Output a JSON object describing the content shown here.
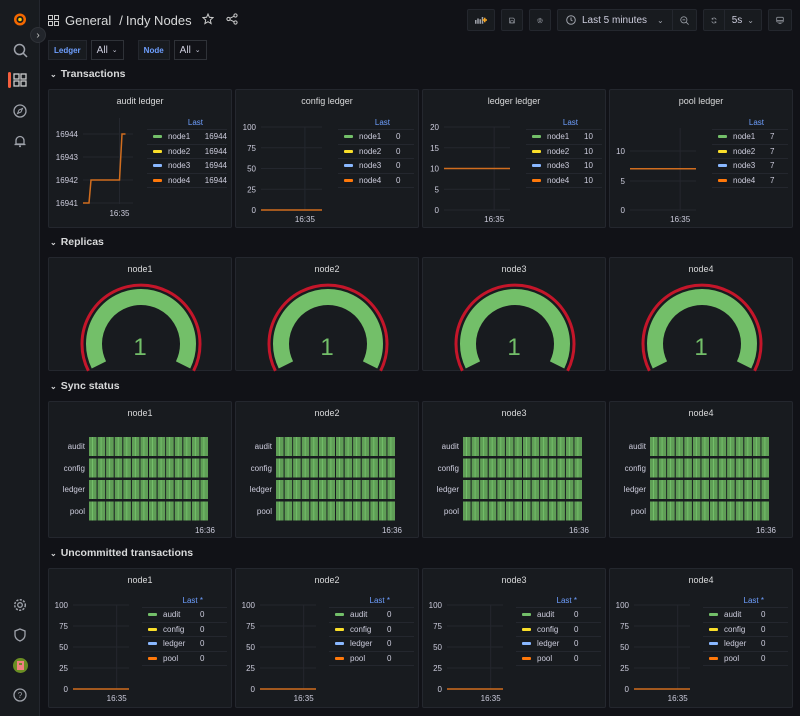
{
  "sidebar": {
    "items": [
      {
        "icon": "grafana-logo-icon"
      },
      {
        "icon": "search-icon"
      },
      {
        "icon": "dashboards-icon",
        "active": true
      },
      {
        "icon": "explore-compass-icon"
      },
      {
        "icon": "alerting-bell-icon"
      },
      {
        "icon": "configuration-gear-icon"
      },
      {
        "icon": "server-admin-shield-icon"
      },
      {
        "icon": "user-avatar-icon"
      },
      {
        "icon": "help-icon"
      }
    ],
    "expand_glyph": "›"
  },
  "header": {
    "folder": "General",
    "separator": "/",
    "title": "Indy Nodes"
  },
  "toolbar": {
    "time_range": "Last 5 minutes",
    "refresh_interval": "5s"
  },
  "variables": [
    {
      "label": "Ledger",
      "value": "All"
    },
    {
      "label": "Node",
      "value": "All"
    }
  ],
  "rows": {
    "transactions": "Transactions",
    "replicas": "Replicas",
    "sync": "Sync status",
    "uncommitted": "Uncommitted transactions"
  },
  "colors": {
    "node1": "#73bf69",
    "node2": "#fade2a",
    "node3": "#8ab8ff",
    "node4": "#ff780a",
    "gauge_green": "#73bf69",
    "gauge_red": "#c4162a",
    "accent": "#6e9fff"
  },
  "transactions": [
    {
      "title": "audit ledger",
      "legend_header": "Last",
      "legend": [
        {
          "name": "node1",
          "value": "16944"
        },
        {
          "name": "node2",
          "value": "16944"
        },
        {
          "name": "node3",
          "value": "16944"
        },
        {
          "name": "node4",
          "value": "16944"
        }
      ],
      "x_tick": "16:35",
      "y_ticks": [
        "16944",
        "16943",
        "16942",
        "16941"
      ]
    },
    {
      "title": "config ledger",
      "legend_header": "Last",
      "legend": [
        {
          "name": "node1",
          "value": "0"
        },
        {
          "name": "node2",
          "value": "0"
        },
        {
          "name": "node3",
          "value": "0"
        },
        {
          "name": "node4",
          "value": "0"
        }
      ],
      "x_tick": "16:35",
      "y_ticks": [
        "100",
        "75",
        "50",
        "25",
        "0"
      ]
    },
    {
      "title": "ledger ledger",
      "legend_header": "Last",
      "legend": [
        {
          "name": "node1",
          "value": "10"
        },
        {
          "name": "node2",
          "value": "10"
        },
        {
          "name": "node3",
          "value": "10"
        },
        {
          "name": "node4",
          "value": "10"
        }
      ],
      "x_tick": "16:35",
      "y_ticks": [
        "20",
        "15",
        "10",
        "5",
        "0"
      ]
    },
    {
      "title": "pool ledger",
      "legend_header": "Last",
      "legend": [
        {
          "name": "node1",
          "value": "7"
        },
        {
          "name": "node2",
          "value": "7"
        },
        {
          "name": "node3",
          "value": "7"
        },
        {
          "name": "node4",
          "value": "7"
        }
      ],
      "x_tick": "16:35",
      "y_ticks": [
        "10",
        "5",
        "0"
      ]
    }
  ],
  "replicas": [
    {
      "title": "node1",
      "value": "1"
    },
    {
      "title": "node2",
      "value": "1"
    },
    {
      "title": "node3",
      "value": "1"
    },
    {
      "title": "node4",
      "value": "1"
    }
  ],
  "sync": [
    {
      "title": "node1",
      "rows": [
        "audit",
        "config",
        "ledger",
        "pool"
      ],
      "x_tick": "16:36"
    },
    {
      "title": "node2",
      "rows": [
        "audit",
        "config",
        "ledger",
        "pool"
      ],
      "x_tick": "16:36"
    },
    {
      "title": "node3",
      "rows": [
        "audit",
        "config",
        "ledger",
        "pool"
      ],
      "x_tick": "16:36"
    },
    {
      "title": "node4",
      "rows": [
        "audit",
        "config",
        "ledger",
        "pool"
      ],
      "x_tick": "16:36"
    }
  ],
  "uncommitted": [
    {
      "title": "node1",
      "legend_header": "Last *",
      "legend": [
        {
          "name": "audit",
          "value": "0"
        },
        {
          "name": "config",
          "value": "0"
        },
        {
          "name": "ledger",
          "value": "0"
        },
        {
          "name": "pool",
          "value": "0"
        }
      ],
      "x_tick": "16:35",
      "y_ticks": [
        "100",
        "75",
        "50",
        "25",
        "0"
      ]
    },
    {
      "title": "node2",
      "legend_header": "Last *",
      "legend": [
        {
          "name": "audit",
          "value": "0"
        },
        {
          "name": "config",
          "value": "0"
        },
        {
          "name": "ledger",
          "value": "0"
        },
        {
          "name": "pool",
          "value": "0"
        }
      ],
      "x_tick": "16:35",
      "y_ticks": [
        "100",
        "75",
        "50",
        "25",
        "0"
      ]
    },
    {
      "title": "node3",
      "legend_header": "Last *",
      "legend": [
        {
          "name": "audit",
          "value": "0"
        },
        {
          "name": "config",
          "value": "0"
        },
        {
          "name": "ledger",
          "value": "0"
        },
        {
          "name": "pool",
          "value": "0"
        }
      ],
      "x_tick": "16:35",
      "y_ticks": [
        "100",
        "75",
        "50",
        "25",
        "0"
      ]
    },
    {
      "title": "node4",
      "legend_header": "Last *",
      "legend": [
        {
          "name": "audit",
          "value": "0"
        },
        {
          "name": "config",
          "value": "0"
        },
        {
          "name": "ledger",
          "value": "0"
        },
        {
          "name": "pool",
          "value": "0"
        }
      ],
      "x_tick": "16:35",
      "y_ticks": [
        "100",
        "75",
        "50",
        "25",
        "0"
      ]
    }
  ],
  "chart_data": [
    {
      "type": "line",
      "title": "audit ledger",
      "ylim": [
        16940.8,
        16944.2
      ],
      "series": [
        {
          "name": "node4",
          "points": [
            [
              0,
              16941
            ],
            [
              0.12,
              16941
            ],
            [
              0.16,
              16942
            ],
            [
              0.73,
              16942
            ],
            [
              0.78,
              16944
            ],
            [
              0.85,
              16944
            ]
          ]
        }
      ]
    },
    {
      "type": "line",
      "title": "config ledger",
      "ylim": [
        0,
        100
      ],
      "series": [
        {
          "name": "node4",
          "points": [
            [
              0,
              0
            ],
            [
              1,
              0
            ]
          ]
        }
      ]
    },
    {
      "type": "line",
      "title": "ledger ledger",
      "ylim": [
        0,
        20
      ],
      "series": [
        {
          "name": "node4",
          "points": [
            [
              0,
              10
            ],
            [
              1,
              10
            ]
          ]
        }
      ]
    },
    {
      "type": "line",
      "title": "pool ledger",
      "ylim": [
        0,
        14
      ],
      "series": [
        {
          "name": "node4",
          "points": [
            [
              0,
              7
            ],
            [
              1,
              7
            ]
          ]
        }
      ]
    }
  ]
}
